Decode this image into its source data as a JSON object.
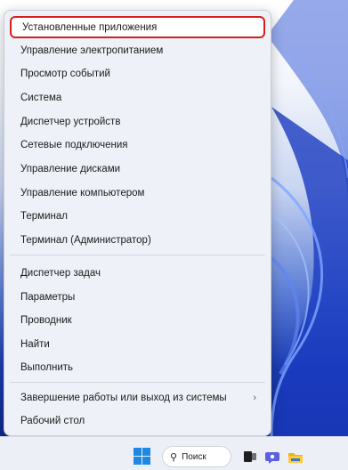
{
  "menu": {
    "groups": [
      {
        "items": [
          {
            "label": "Установленные приложения"
          },
          {
            "label": "Управление электропитанием"
          },
          {
            "label": "Просмотр событий"
          },
          {
            "label": "Система"
          },
          {
            "label": "Диспетчер устройств"
          },
          {
            "label": "Сетевые подключения"
          },
          {
            "label": "Управление дисками"
          },
          {
            "label": "Управление компьютером"
          },
          {
            "label": "Терминал"
          },
          {
            "label": "Терминал (Администратор)"
          }
        ]
      },
      {
        "items": [
          {
            "label": "Диспетчер задач"
          },
          {
            "label": "Параметры"
          },
          {
            "label": "Проводник"
          },
          {
            "label": "Найти"
          },
          {
            "label": "Выполнить"
          }
        ]
      },
      {
        "items": [
          {
            "label": "Завершение работы или выход из системы",
            "submenu_glyph": "›"
          },
          {
            "label": "Рабочий стол"
          }
        ]
      }
    ]
  },
  "taskbar": {
    "search_label": "Поиск",
    "search_icon": "search-icon",
    "icons": [
      "windows-start-icon",
      "search-icon",
      "task-view-icon",
      "chat-icon",
      "file-explorer-icon"
    ]
  },
  "colors": {
    "highlight_border": "#d4201c",
    "start_blue": "#1e88e5"
  }
}
